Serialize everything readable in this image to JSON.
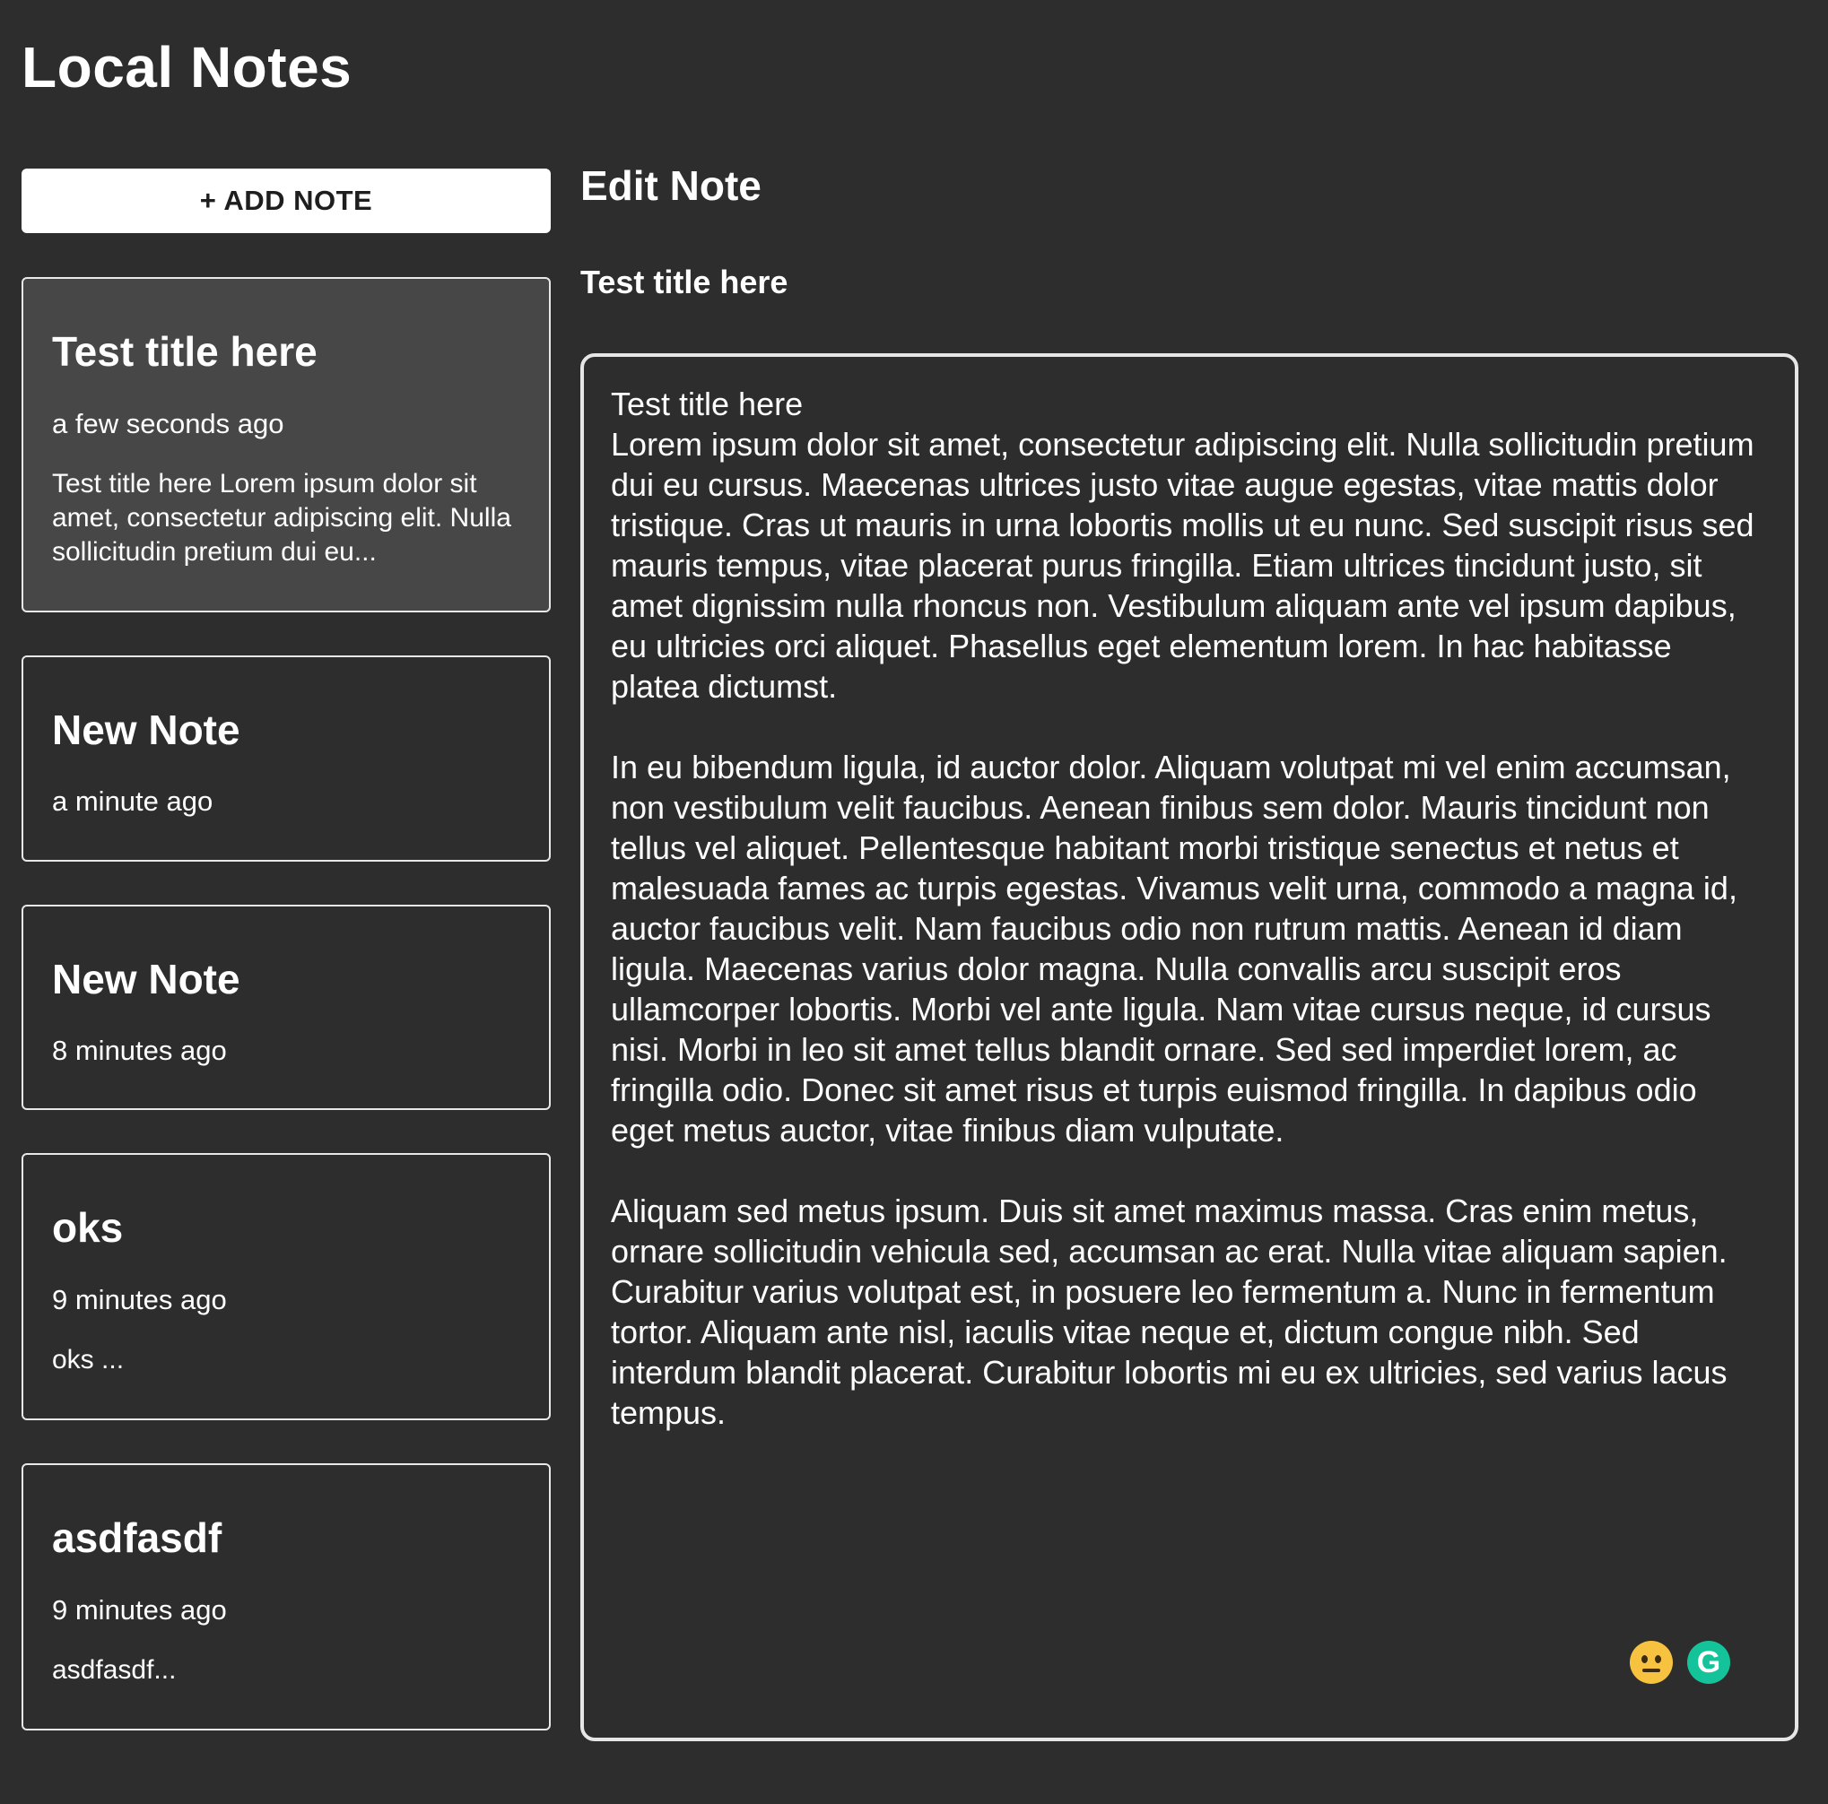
{
  "app": {
    "title": "Local Notes"
  },
  "sidebar": {
    "add_note_label": "+ ADD NOTE",
    "notes": [
      {
        "title": "Test title here",
        "time": "a few seconds ago",
        "preview": "Test title here Lorem ipsum dolor sit amet, consectetur adipiscing elit. Nulla sollicitudin pretium dui eu...",
        "active": true
      },
      {
        "title": "New Note",
        "time": "a minute ago",
        "preview": "",
        "active": false
      },
      {
        "title": "New Note",
        "time": "8 minutes ago",
        "preview": "",
        "active": false
      },
      {
        "title": "oks",
        "time": "9 minutes ago",
        "preview": "oks ...",
        "active": false
      },
      {
        "title": "asdfasdf",
        "time": "9 minutes ago",
        "preview": "asdfasdf...",
        "active": false
      }
    ]
  },
  "editor": {
    "heading": "Edit Note",
    "note_title": "Test title here",
    "body": "Test title here\nLorem ipsum dolor sit amet, consectetur adipiscing elit. Nulla sollicitudin pretium dui eu cursus. Maecenas ultrices justo vitae augue egestas, vitae mattis dolor tristique. Cras ut mauris in urna lobortis mollis ut eu nunc. Sed suscipit risus sed mauris tempus, vitae placerat purus fringilla. Etiam ultrices tincidunt justo, sit amet dignissim nulla rhoncus non. Vestibulum aliquam ante vel ipsum dapibus, eu ultricies orci aliquet. Phasellus eget elementum lorem. In hac habitasse platea dictumst.\n\nIn eu bibendum ligula, id auctor dolor. Aliquam volutpat mi vel enim accumsan, non vestibulum velit faucibus. Aenean finibus sem dolor. Mauris tincidunt non tellus vel aliquet. Pellentesque habitant morbi tristique senectus et netus et malesuada fames ac turpis egestas. Vivamus velit urna, commodo a magna id, auctor faucibus velit. Nam faucibus odio non rutrum mattis. Aenean id diam ligula. Maecenas varius dolor magna. Nulla convallis arcu suscipit eros ullamcorper lobortis. Morbi vel ante ligula. Nam vitae cursus neque, id cursus nisi. Morbi in leo sit amet tellus blandit ornare. Sed sed imperdiet lorem, ac fringilla odio. Donec sit amet risus et turpis euismod fringilla. In dapibus odio eget metus auctor, vitae finibus diam vulputate.\n\nAliquam sed metus ipsum. Duis sit amet maximus massa. Cras enim metus, ornare sollicitudin vehicula sed, accumsan ac erat. Nulla vitae aliquam sapien. Curabitur varius volutpat est, in posuere leo fermentum a. Nunc in fermentum tortor. Aliquam ante nisl, iaculis vitae neque et, dictum congue nibh. Sed interdum blandit placerat. Curabitur lobortis mi eu ex ultricies, sed varius lacus tempus.",
    "extension_icons": [
      "neutral-face-emoji-icon",
      "grammarly-icon"
    ],
    "grammarly_glyph": "G"
  },
  "colors": {
    "background": "#2d2d2d",
    "active_card": "#474747",
    "card_border": "#e8e8e8",
    "button_bg": "#ffffff",
    "text": "#ffffff",
    "emoji_yellow": "#f7c23f",
    "grammarly_green": "#15c39a"
  }
}
